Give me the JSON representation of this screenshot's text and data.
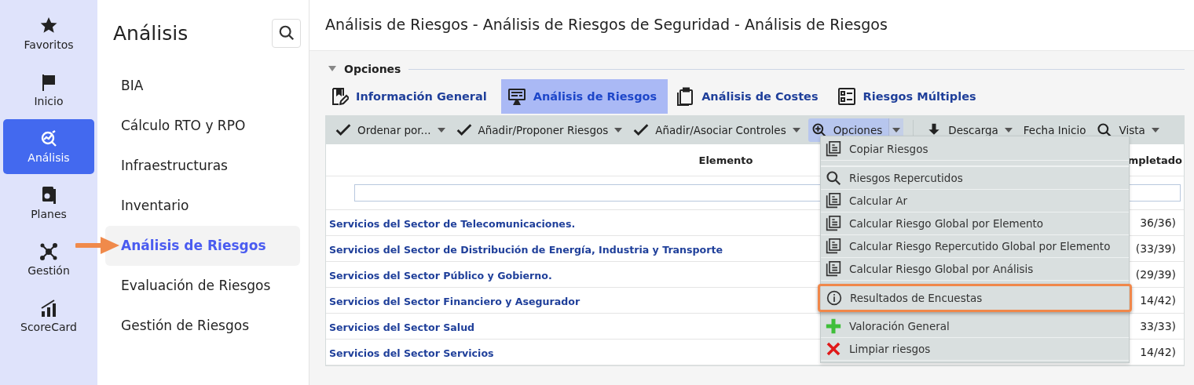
{
  "nav": [
    {
      "kind": "star",
      "label": "Favoritos",
      "selected": false
    },
    {
      "kind": "flag",
      "label": "Inicio",
      "selected": false
    },
    {
      "kind": "analysis",
      "label": "Análisis",
      "selected": true
    },
    {
      "kind": "plans",
      "label": "Planes",
      "selected": false
    },
    {
      "kind": "network",
      "label": "Gestión",
      "selected": false
    },
    {
      "kind": "chart",
      "label": "ScoreCard",
      "selected": false
    }
  ],
  "sidebar": {
    "title": "Análisis",
    "items": [
      {
        "label": "BIA",
        "selected": false,
        "pointer_arrow": false
      },
      {
        "label": "Cálculo RTO y RPO",
        "selected": false,
        "pointer_arrow": false
      },
      {
        "label": "Infraestructuras",
        "selected": false,
        "pointer_arrow": false
      },
      {
        "label": "Inventario",
        "selected": false,
        "pointer_arrow": false
      },
      {
        "label": "Análisis de Riesgos",
        "selected": true,
        "pointer_arrow": true
      },
      {
        "label": "Evaluación de Riesgos",
        "selected": false,
        "pointer_arrow": false
      },
      {
        "label": "Gestión de Riesgos",
        "selected": false,
        "pointer_arrow": false
      }
    ]
  },
  "page_title": "Análisis de Riesgos - Análisis de Riesgos de Seguridad - Análisis de Riesgos",
  "section": {
    "label": "Opciones",
    "expanded": true
  },
  "tabs": [
    {
      "kind": "edit",
      "label": "Información General",
      "selected": false
    },
    {
      "kind": "monitor",
      "label": "Análisis de Riesgos",
      "selected": true
    },
    {
      "kind": "clipboard",
      "label": "Análisis de Costes",
      "selected": false
    },
    {
      "kind": "list",
      "label": "Riesgos Múltiples",
      "selected": false
    }
  ],
  "toolbar": [
    {
      "kind": "check",
      "label": "Ordenar por...",
      "dropdown": true,
      "selected": false
    },
    {
      "kind": "check",
      "label": "Añadir/Proponer Riesgos",
      "dropdown": true,
      "selected": false
    },
    {
      "kind": "check",
      "label": "Añadir/Asociar Controles",
      "dropdown": true,
      "selected": false
    },
    {
      "kind": "zoom",
      "label": "Opciones",
      "dropdown": true,
      "selected": true
    },
    {
      "kind": "download",
      "label": "Descarga",
      "dropdown": true,
      "selected": false
    },
    {
      "kind": "text",
      "label": "Fecha Inicio",
      "dropdown": false,
      "selected": false
    },
    {
      "kind": "search",
      "label": "Vista",
      "dropdown": true,
      "selected": false
    }
  ],
  "table": {
    "columns": [
      "Elemento",
      "mpletado"
    ],
    "rows": [
      {
        "element": "Servicios del Sector de Telecomunicaciones.",
        "column_2": "36/36)"
      },
      {
        "element": "Servicios del Sector de Distribución de Energía, Industria y Transporte",
        "column_2": "(33/39)"
      },
      {
        "element": "Servicios del Sector Público y Gobierno.",
        "column_2": "(29/39)"
      },
      {
        "element": "Servicios del Sector Financiero y Asegurador",
        "column_2": "14/42)"
      },
      {
        "element": "Servicios del Sector Salud",
        "column_2": "33/33)"
      },
      {
        "element": "Servicios del Sector Servicios",
        "column_2": "14/42)"
      }
    ]
  },
  "menu": [
    {
      "kind": "doc",
      "label": "Copiar Riesgos",
      "divider_after": true,
      "outlined": false
    },
    {
      "kind": "search",
      "label": "Riesgos Repercutidos",
      "divider_after": false,
      "outlined": false
    },
    {
      "kind": "doc",
      "label": "Calcular Ar",
      "divider_after": false,
      "outlined": false
    },
    {
      "kind": "doc",
      "label": "Calcular Riesgo Global por Elemento",
      "divider_after": false,
      "outlined": false
    },
    {
      "kind": "doc",
      "label": "Calcular Riesgo Repercutido Global por Elemento",
      "divider_after": false,
      "outlined": false
    },
    {
      "kind": "doc",
      "label": "Calcular Riesgo Global por Análisis",
      "divider_after": false,
      "outlined": false
    },
    {
      "kind": "info",
      "label": "Resultados de Encuestas",
      "divider_after": false,
      "outlined": true
    },
    {
      "kind": "plus",
      "label": "Valoración General",
      "divider_after": false,
      "outlined": false
    },
    {
      "kind": "cross",
      "label": "Limpiar riesgos",
      "divider_after": false,
      "outlined": false
    }
  ]
}
